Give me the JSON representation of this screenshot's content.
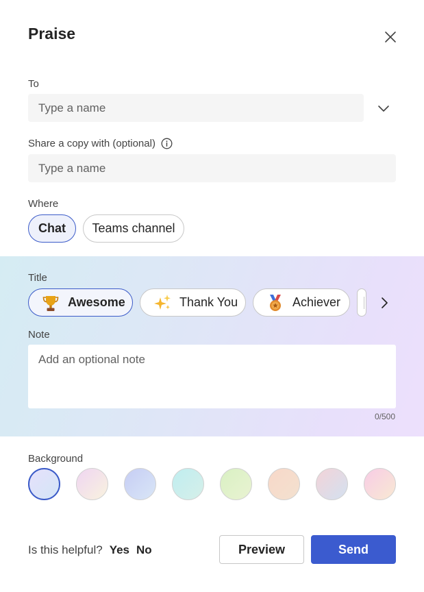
{
  "dialog": {
    "title": "Praise",
    "close_icon": "close-icon"
  },
  "to": {
    "label": "To",
    "placeholder": "Type a name",
    "dropdown_icon": "chevron-down-icon"
  },
  "share": {
    "label": "Share a copy with (optional)",
    "info_icon": "info-icon",
    "placeholder": "Type a name"
  },
  "where": {
    "label": "Where",
    "options": [
      {
        "label": "Chat",
        "selected": true
      },
      {
        "label": "Teams channel",
        "selected": false
      }
    ]
  },
  "title_section": {
    "label": "Title",
    "options": [
      {
        "label": "Awesome",
        "icon": "trophy-icon",
        "selected": true
      },
      {
        "label": "Thank You",
        "icon": "sparkles-icon",
        "selected": false
      },
      {
        "label": "Achiever",
        "icon": "medal-icon",
        "selected": false
      }
    ],
    "next_icon": "chevron-right-icon"
  },
  "note": {
    "label": "Note",
    "placeholder": "Add an optional note",
    "counter": "0/500"
  },
  "background": {
    "label": "Background",
    "swatches": [
      {
        "name": "lavender-blue",
        "colors": [
          "#e6e0fb",
          "#d3e6f7"
        ],
        "selected": true
      },
      {
        "name": "pink-cream",
        "colors": [
          "#efd5f2",
          "#f9f3df"
        ],
        "selected": false
      },
      {
        "name": "periwinkle",
        "colors": [
          "#c6cdf4",
          "#d9e6f7"
        ],
        "selected": false
      },
      {
        "name": "aqua",
        "colors": [
          "#bfeef0",
          "#d6efe9"
        ],
        "selected": false
      },
      {
        "name": "lime",
        "colors": [
          "#d9f0c3",
          "#e9f3d2"
        ],
        "selected": false
      },
      {
        "name": "peach",
        "colors": [
          "#f8d8c9",
          "#f3e1cf"
        ],
        "selected": false
      },
      {
        "name": "rose-sky",
        "colors": [
          "#f3d3d8",
          "#d3e1f0"
        ],
        "selected": false
      },
      {
        "name": "pink-gold",
        "colors": [
          "#f7cce6",
          "#f9e9d3"
        ],
        "selected": false
      }
    ]
  },
  "footer": {
    "helpful_text": "Is this helpful?",
    "yes": "Yes",
    "no": "No",
    "preview": "Preview",
    "send": "Send"
  },
  "colors": {
    "accent": "#3b5bcf",
    "selected_border": "#3a5ac8"
  }
}
